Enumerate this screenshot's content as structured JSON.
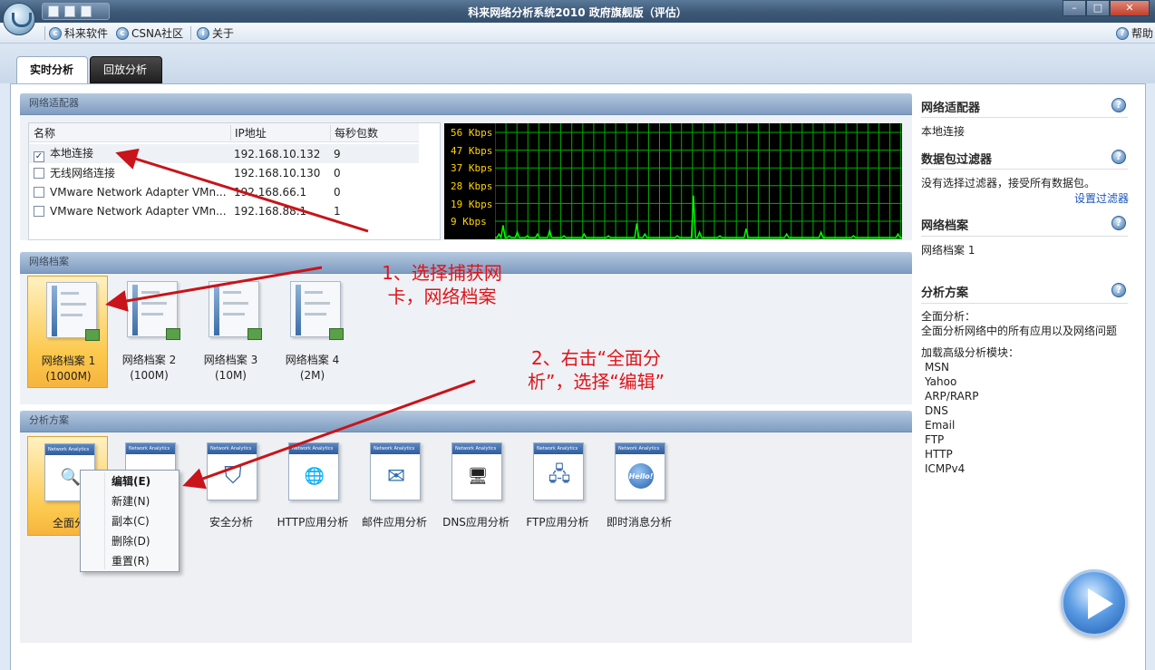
{
  "window": {
    "title": "科来网络分析系统2010 政府旗舰版（评估）",
    "controls": [
      "–",
      "□",
      "✕"
    ]
  },
  "menu": {
    "items": [
      "科来软件",
      "CSNA社区",
      "关于"
    ],
    "help": "帮助"
  },
  "tabs": [
    {
      "label": "实时分析",
      "active": true
    },
    {
      "label": "回放分析",
      "active": false
    }
  ],
  "adapters": {
    "title": "网络适配器",
    "columns": [
      "名称",
      "IP地址",
      "每秒包数"
    ],
    "rows": [
      {
        "name": "本地连接",
        "ip": "192.168.10.132",
        "pps": "9",
        "checked": true
      },
      {
        "name": "无线网络连接",
        "ip": "192.168.10.130",
        "pps": "0",
        "checked": false
      },
      {
        "name": "VMware Network Adapter VMn...",
        "ip": "192.168.66.1",
        "pps": "0",
        "checked": false
      },
      {
        "name": "VMware Network Adapter VMn...",
        "ip": "192.168.88.1",
        "pps": "1",
        "checked": false
      }
    ]
  },
  "chart_data": {
    "type": "line",
    "title": "",
    "ylabel": "",
    "yticks": [
      "56 Kbps",
      "47 Kbps",
      "37 Kbps",
      "28 Kbps",
      "19 Kbps",
      "9 Kbps"
    ],
    "ylim": [
      0,
      60
    ],
    "grid": true,
    "series": [
      {
        "values": [
          0,
          0,
          2,
          0,
          7,
          0,
          0,
          1,
          0,
          0,
          0,
          3,
          0,
          0,
          0,
          0,
          1,
          0,
          0,
          0,
          0,
          2,
          0,
          0,
          0,
          0,
          0,
          4,
          0,
          0,
          0,
          0,
          0,
          0,
          1,
          0,
          0,
          0,
          0,
          0,
          0,
          0,
          0,
          0,
          2,
          0,
          0,
          0,
          0,
          0,
          0,
          0,
          0,
          0,
          0,
          0,
          1,
          0,
          0,
          0,
          0,
          0,
          0,
          0,
          0,
          0,
          0,
          0,
          0,
          0,
          8,
          0,
          0,
          0,
          2,
          0,
          0,
          0,
          0,
          0,
          0,
          0,
          0,
          0,
          0,
          0,
          0,
          0,
          0,
          0,
          1,
          0,
          0,
          0,
          0,
          0,
          0,
          0,
          24,
          0,
          0,
          3,
          0,
          0,
          0,
          0,
          0,
          0,
          0,
          0,
          0,
          1,
          0,
          0,
          0,
          0,
          0,
          0,
          0,
          0,
          0,
          0,
          0,
          0,
          5,
          0,
          0,
          0,
          0,
          0,
          0,
          0,
          0,
          0,
          0,
          0,
          0,
          0,
          0,
          0,
          0,
          0,
          0,
          0,
          2,
          0,
          0,
          0,
          0,
          0,
          0,
          0,
          0,
          0,
          0,
          0,
          0,
          0,
          0,
          0,
          0,
          3,
          0,
          0,
          0,
          0,
          0,
          0,
          0,
          0,
          0,
          0,
          0,
          0,
          0,
          0,
          0,
          1,
          0,
          0,
          0,
          0,
          0,
          0,
          0,
          0,
          0,
          0,
          0,
          0,
          0,
          0,
          0,
          0,
          0,
          0,
          0,
          0,
          0,
          2,
          0,
          0
        ]
      }
    ],
    "colors": {
      "background": "#000000",
      "grid": "#00b000",
      "line": "#00ff00",
      "labels": "#ffd400"
    }
  },
  "profiles": {
    "title": "网络档案",
    "items": [
      {
        "name": "网络档案 1",
        "size": "(1000M)",
        "selected": true
      },
      {
        "name": "网络档案 2",
        "size": "(100M)",
        "selected": false
      },
      {
        "name": "网络档案 3",
        "size": "(10M)",
        "selected": false
      },
      {
        "name": "网络档案 4",
        "size": "(2M)",
        "selected": false
      }
    ]
  },
  "analysis": {
    "title": "分析方案",
    "box_header": "Network Analytics",
    "items": [
      {
        "label": "全面分析",
        "icon": "magnifier-icon",
        "glyph": "🔍",
        "selected": true
      },
      {
        "label": "",
        "icon": "document-icon",
        "glyph": "",
        "selected": false
      },
      {
        "label": "安全分析",
        "icon": "shield-icon",
        "glyph": "⛉",
        "selected": false
      },
      {
        "label": "HTTP应用分析",
        "icon": "globe-icon",
        "glyph": "🌐",
        "selected": false
      },
      {
        "label": "邮件应用分析",
        "icon": "mail-icon",
        "glyph": "✉",
        "selected": false
      },
      {
        "label": "DNS应用分析",
        "icon": "server-icon",
        "glyph": "🖥",
        "selected": false
      },
      {
        "label": "FTP应用分析",
        "icon": "network-icon",
        "glyph": "🖧",
        "selected": false
      },
      {
        "label": "即时消息分析",
        "icon": "chat-icon",
        "glyph": "Hello!",
        "selected": false
      }
    ],
    "visible_label_fragment": "全面分"
  },
  "context_menu": [
    "编辑(E)",
    "新建(N)",
    "副本(C)",
    "删除(D)",
    "重置(R)"
  ],
  "sidebar": {
    "adapter_title": "网络适配器",
    "adapter_value": "本地连接",
    "filter_title": "数据包过滤器",
    "filter_value": "没有选择过滤器，接受所有数据包。",
    "filter_link": "设置过滤器",
    "profile_title": "网络档案",
    "profile_value": "网络档案 1",
    "analysis_title": "分析方案",
    "analysis_line1": "全面分析：",
    "analysis_line2": "全面分析网络中的所有应用以及网络问题",
    "modules_title": "加载高级分析模块：",
    "modules": [
      "MSN",
      "Yahoo",
      "ARP/RARP",
      "DNS",
      "Email",
      "FTP",
      "HTTP",
      "ICMPv4"
    ]
  },
  "annotations": {
    "step1": [
      "1、选择捕获网",
      "卡，网络档案"
    ],
    "step2": [
      "2、右击“全面分",
      "析”，选择“编辑”"
    ],
    "arrow_color": "#c8141a"
  }
}
